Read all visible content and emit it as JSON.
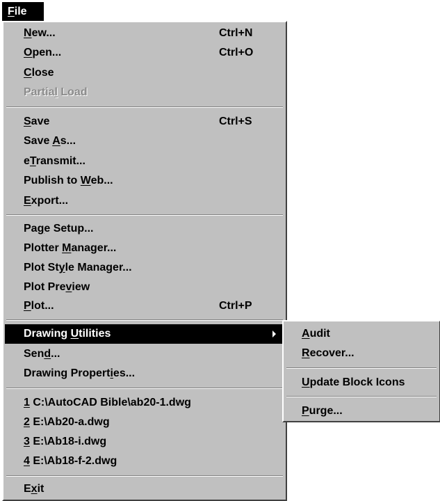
{
  "menubar": {
    "file": {
      "pre": "",
      "key": "F",
      "post": "ile"
    }
  },
  "file_menu": {
    "new": {
      "pre": "",
      "key": "N",
      "post": "ew...",
      "shortcut": "Ctrl+N"
    },
    "open": {
      "pre": "",
      "key": "O",
      "post": "pen...",
      "shortcut": "Ctrl+O"
    },
    "close": {
      "pre": "",
      "key": "C",
      "post": "lose"
    },
    "partial_load": {
      "pre": "Partia",
      "key": "l",
      "post": " Load"
    },
    "save": {
      "pre": "",
      "key": "S",
      "post": "ave",
      "shortcut": "Ctrl+S"
    },
    "save_as": {
      "pre": "Save ",
      "key": "A",
      "post": "s..."
    },
    "etransmit": {
      "pre": "e",
      "key": "T",
      "post": "ransmit..."
    },
    "publish_web": {
      "pre": "Publish to ",
      "key": "W",
      "post": "eb..."
    },
    "export": {
      "pre": "",
      "key": "E",
      "post": "xport..."
    },
    "page_setup": {
      "pre": "Pa",
      "key": "g",
      "post": "e Setup..."
    },
    "plotter_manager": {
      "pre": "Plotter ",
      "key": "M",
      "post": "anager..."
    },
    "plot_style_manager": {
      "pre": "Plot St",
      "key": "y",
      "post": "le Manager..."
    },
    "plot_preview": {
      "pre": "Plot Pre",
      "key": "v",
      "post": "iew"
    },
    "plot": {
      "pre": "",
      "key": "P",
      "post": "lot...",
      "shortcut": "Ctrl+P"
    },
    "drawing_utilities": {
      "pre": "Drawing ",
      "key": "U",
      "post": "tilities"
    },
    "send": {
      "pre": "Sen",
      "key": "d",
      "post": "..."
    },
    "drawing_properties": {
      "pre": "Drawing Propert",
      "key": "i",
      "post": "es..."
    },
    "recent1": {
      "pre": "",
      "key": "1",
      "post": " C:\\AutoCAD Bible\\ab20-1.dwg"
    },
    "recent2": {
      "pre": "",
      "key": "2",
      "post": " E:\\Ab20-a.dwg"
    },
    "recent3": {
      "pre": "",
      "key": "3",
      "post": " E:\\Ab18-i.dwg"
    },
    "recent4": {
      "pre": "",
      "key": "4",
      "post": " E:\\Ab18-f-2.dwg"
    },
    "exit": {
      "pre": "E",
      "key": "x",
      "post": "it"
    }
  },
  "submenu": {
    "audit": {
      "pre": "",
      "key": "A",
      "post": "udit"
    },
    "recover": {
      "pre": "",
      "key": "R",
      "post": "ecover..."
    },
    "update_block_icons": {
      "pre": "",
      "key": "U",
      "post": "pdate Block Icons"
    },
    "purge": {
      "pre": "",
      "key": "P",
      "post": "urge..."
    }
  },
  "colors": {
    "menu_face": "#c0c0c0",
    "highlight": "#000000",
    "disabled_text": "#8a8a8a"
  }
}
